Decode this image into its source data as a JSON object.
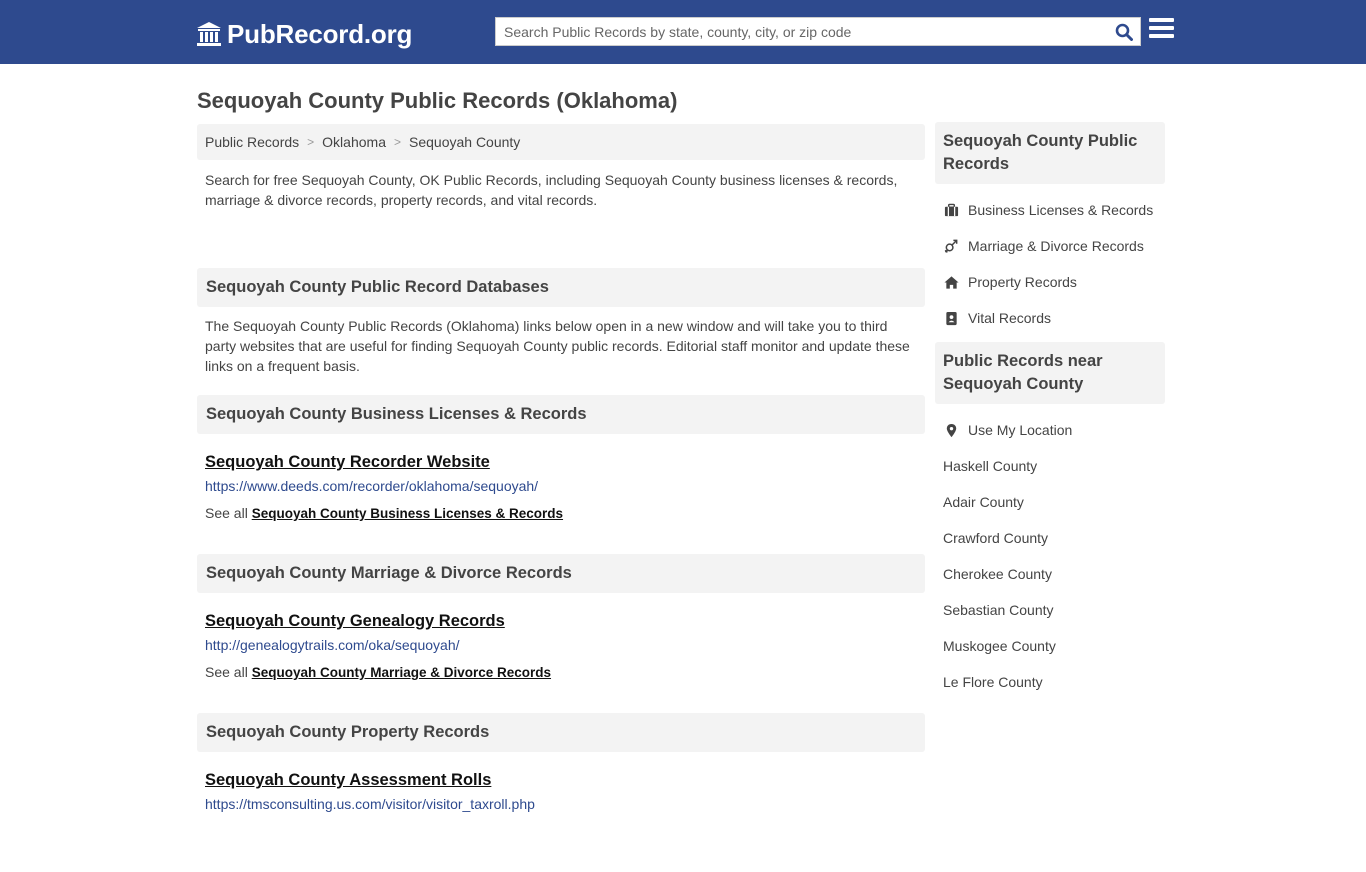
{
  "header": {
    "logo_text": "PubRecord.org",
    "search_placeholder": "Search Public Records by state, county, city, or zip code"
  },
  "page_title": "Sequoyah County Public Records (Oklahoma)",
  "breadcrumb": [
    "Public Records",
    "Oklahoma",
    "Sequoyah County"
  ],
  "intro": "Search for free Sequoyah County, OK Public Records, including Sequoyah County business licenses & records, marriage & divorce records, property records, and vital records.",
  "databases": {
    "heading": "Sequoyah County Public Record Databases",
    "text": "The Sequoyah County Public Records (Oklahoma) links below open in a new window and will take you to third party websites that are useful for finding Sequoyah County public records. Editorial staff monitor and update these links on a frequent basis."
  },
  "sections": [
    {
      "heading": "Sequoyah County Business Licenses & Records",
      "record_title": "Sequoyah County Recorder Website",
      "record_url": "https://www.deeds.com/recorder/oklahoma/sequoyah/",
      "see_all_prefix": "See all",
      "see_all_link": "Sequoyah County Business Licenses & Records"
    },
    {
      "heading": "Sequoyah County Marriage & Divorce Records",
      "record_title": "Sequoyah County Genealogy Records",
      "record_url": "http://genealogytrails.com/oka/sequoyah/",
      "see_all_prefix": "See all",
      "see_all_link": "Sequoyah County Marriage & Divorce Records"
    },
    {
      "heading": "Sequoyah County Property Records",
      "record_title": "Sequoyah County Assessment Rolls",
      "record_url": "https://tmsconsulting.us.com/visitor/visitor_taxroll.php"
    }
  ],
  "sidebar": {
    "records_heading": "Sequoyah County Public Records",
    "records_links": [
      {
        "label": "Business Licenses & Records",
        "icon": "briefcase-icon"
      },
      {
        "label": "Marriage & Divorce Records",
        "icon": "gender-icon"
      },
      {
        "label": "Property Records",
        "icon": "home-icon"
      },
      {
        "label": "Vital Records",
        "icon": "id-card-icon"
      }
    ],
    "near_heading": "Public Records near Sequoyah County",
    "use_location": "Use My Location",
    "near_counties": [
      "Haskell County",
      "Adair County",
      "Crawford County",
      "Cherokee County",
      "Sebastian County",
      "Muskogee County",
      "Le Flore County"
    ]
  },
  "colors": {
    "header_bg": "#2e4a8e",
    "section_bg": "#f3f3f3",
    "link_url": "#2e4a8e"
  }
}
